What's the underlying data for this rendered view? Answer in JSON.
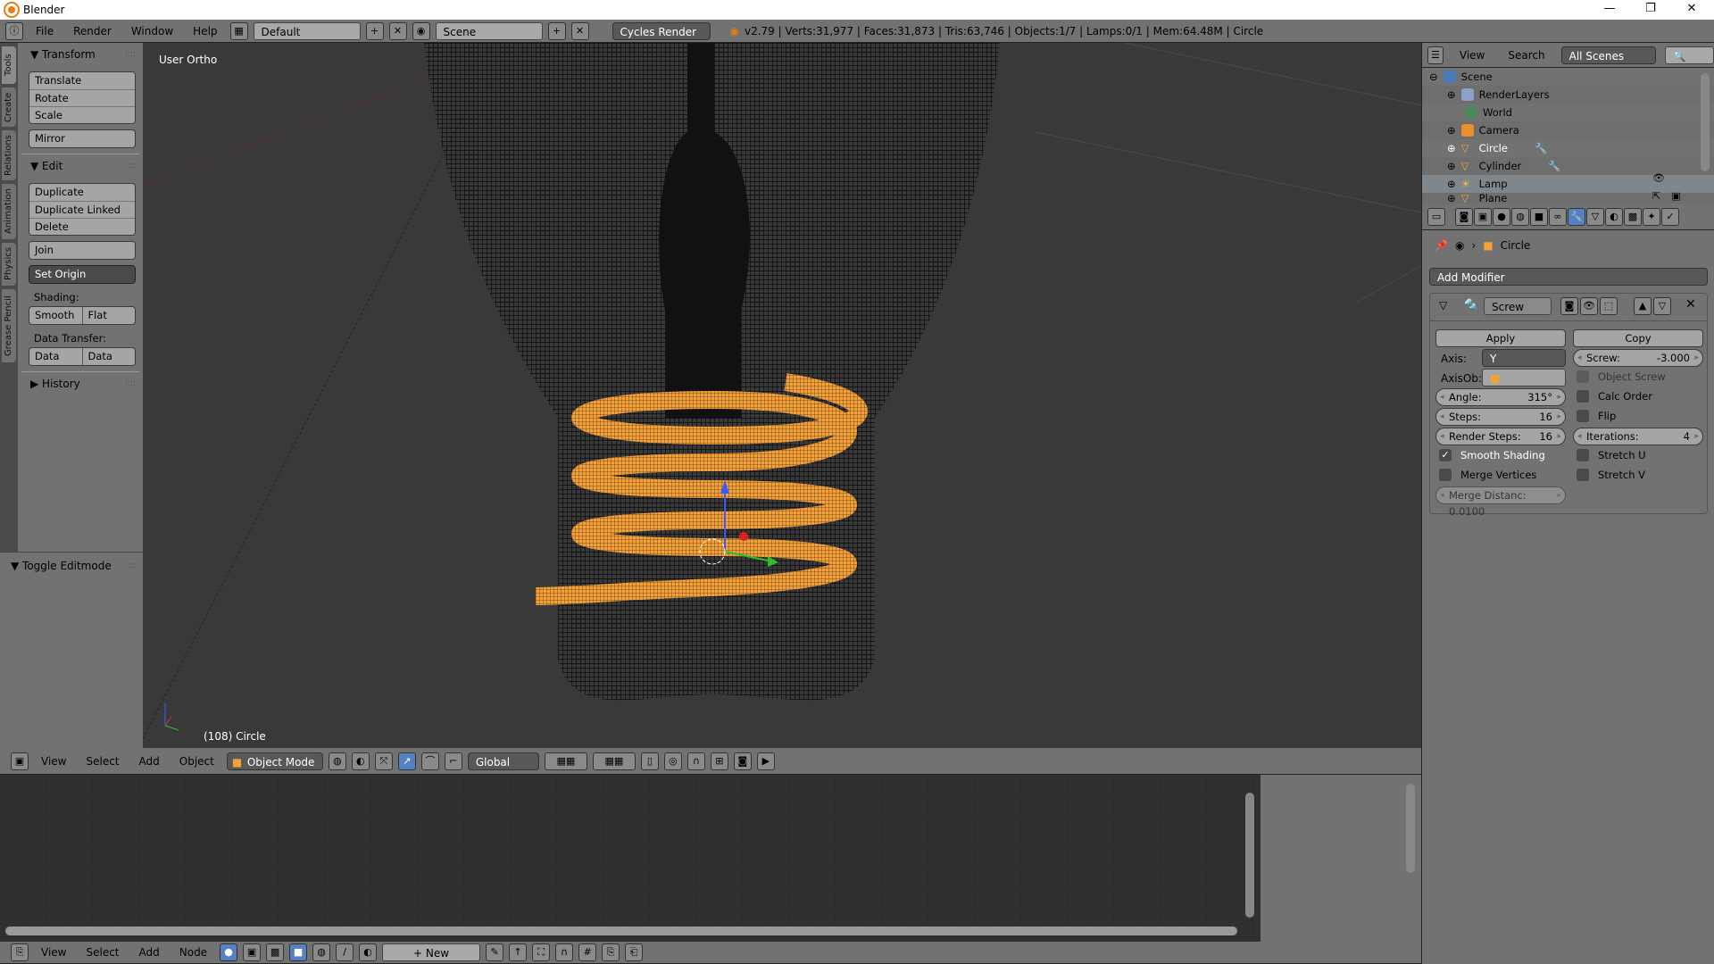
{
  "window": {
    "title": "Blender",
    "minimize": "—",
    "restore": "❐",
    "close": "✕"
  },
  "topbar": {
    "menus": [
      "File",
      "Render",
      "Window",
      "Help"
    ],
    "layout": "Default",
    "scene": "Scene",
    "engine": "Cycles Render",
    "stats": "v2.79 | Verts:31,977 | Faces:31,873 | Tris:63,746 | Objects:1/7 | Lamps:0/1 | Mem:64.48M | Circle"
  },
  "lefttabs": [
    "Tools",
    "Create",
    "Relations",
    "Animation",
    "Physics",
    "Grease Pencil"
  ],
  "toolpanel": {
    "transform": {
      "title": "Transform",
      "buttons": [
        "Translate",
        "Rotate",
        "Scale"
      ],
      "mirror": "Mirror"
    },
    "edit": {
      "title": "Edit",
      "buttons": [
        "Duplicate",
        "Duplicate Linked",
        "Delete"
      ],
      "join": "Join",
      "set_origin": "Set Origin",
      "shading_label": "Shading:",
      "smooth": "Smooth",
      "flat": "Flat",
      "data_transfer_label": "Data Transfer:",
      "data": "Data",
      "data_layout": "Data Layo"
    },
    "history": "History",
    "toggle_editmode": "Toggle Editmode"
  },
  "viewport": {
    "view_label": "User Ortho",
    "object_label": "(108) Circle",
    "object_color": "#f5a139",
    "wire_color": "#000000"
  },
  "view3d_header": {
    "menus": [
      "View",
      "Select",
      "Add",
      "Object"
    ],
    "mode": "Object Mode",
    "orientation": "Global"
  },
  "node_header": {
    "menus": [
      "View",
      "Select",
      "Add",
      "Node"
    ],
    "new": "New"
  },
  "outliner": {
    "menus": [
      "View",
      "Search"
    ],
    "filter": "All Scenes",
    "items": [
      {
        "name": "Scene",
        "icon": "scene-icon"
      },
      {
        "name": "RenderLayers",
        "icon": "render-layers-icon"
      },
      {
        "name": "World",
        "icon": "world-icon"
      },
      {
        "name": "Camera",
        "icon": "camera-icon"
      },
      {
        "name": "Circle",
        "icon": "mesh-icon"
      },
      {
        "name": "Cylinder",
        "icon": "mesh-icon"
      },
      {
        "name": "Lamp",
        "icon": "lamp-icon"
      },
      {
        "name": "Plane",
        "icon": "mesh-icon"
      }
    ]
  },
  "properties": {
    "context": "Circle",
    "add_modifier": "Add Modifier",
    "modifier": {
      "name": "Screw",
      "apply": "Apply",
      "copy": "Copy",
      "axis_label": "Axis:",
      "axis": "Y",
      "axisob_label": "AxisOb:",
      "angle_label": "Angle:",
      "angle": "315°",
      "steps_label": "Steps:",
      "steps": "16",
      "render_steps_label": "Render Steps:",
      "render_steps": "16",
      "smooth_shading": "Smooth Shading",
      "smooth_shading_checked": true,
      "merge_vertices": "Merge Vertices",
      "merge_vertices_checked": false,
      "merge_distance": "Merge Distanc: 0.0100",
      "screw_label": "Screw:",
      "screw": "-3.000",
      "object_screw": "Object Screw",
      "calc_order": "Calc Order",
      "flip": "Flip",
      "iterations_label": "Iterations:",
      "iterations": "4",
      "stretch_u": "Stretch U",
      "stretch_v": "Stretch V"
    }
  }
}
